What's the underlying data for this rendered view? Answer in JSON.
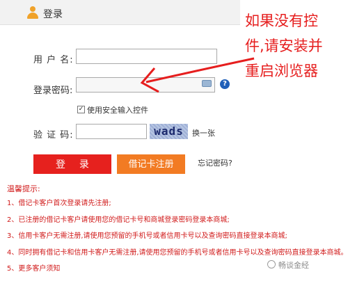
{
  "header": {
    "title": "登录"
  },
  "form": {
    "username_label": "用 户 名:",
    "username_value": "",
    "password_label": "登录密码:",
    "password_value": "",
    "secure_input_label": "使用安全输入控件",
    "secure_input_checked": true,
    "captcha_label": "验 证 码:",
    "captcha_value": "",
    "captcha_text": "wads",
    "captcha_refresh": "换一张",
    "help_glyph": "?"
  },
  "buttons": {
    "login": "登 录",
    "register": "借记卡注册",
    "forgot": "忘记密码?"
  },
  "tips": {
    "title": "温馨提示:",
    "items": [
      "1、借记卡客户首次登录请先注册;",
      "2、已注册的借记卡客户请使用您的借记卡号和商城登录密码登录本商城;",
      "3、信用卡客户无需注册,请使用您预留的手机号或者信用卡号以及查询密码直接登录本商城;",
      "4、同时拥有借记卡和信用卡客户无需注册,请使用您预留的手机号或者信用卡号以及查询密码直接登录本商城。",
      "5、更多客户须知"
    ]
  },
  "annotation": {
    "lines": [
      "如果没有控",
      "件,请安装并",
      "重启浏览器"
    ]
  },
  "watermark": "畅谈金经",
  "colors": {
    "red": "#e6211e",
    "orange": "#f27b23",
    "tip_red": "#d11b1b",
    "accent_blue": "#1f5fb8"
  }
}
